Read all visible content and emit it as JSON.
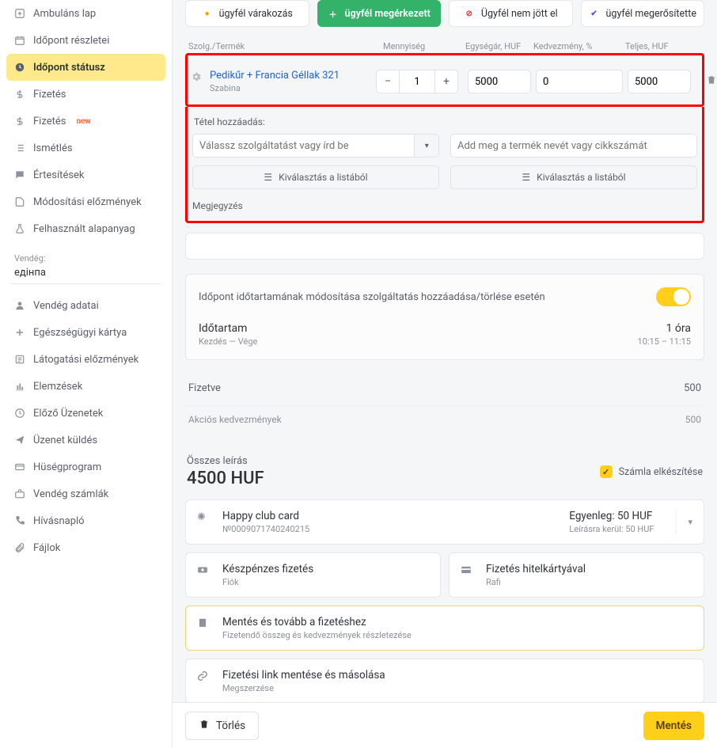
{
  "sidebar": {
    "items": [
      {
        "icon": "plus-square",
        "label": "Ambuláns lap"
      },
      {
        "icon": "calendar",
        "label": "Időpont részletei"
      },
      {
        "icon": "clock",
        "label": "Időpont státusz",
        "active": true
      },
      {
        "icon": "dollar",
        "label": "Fizetés"
      },
      {
        "icon": "dollar",
        "label": "Fizetés",
        "new": true
      },
      {
        "icon": "list",
        "label": "Ismétlés"
      },
      {
        "icon": "chat",
        "label": "Értesítések"
      },
      {
        "icon": "file",
        "label": "Módosítási előzmények"
      },
      {
        "icon": "flask",
        "label": "Felhasznált alapanyag"
      }
    ],
    "guest_label": "Vendég:",
    "guest_name": "едінпа",
    "guest_items": [
      {
        "icon": "user",
        "label": "Vendég adatai"
      },
      {
        "icon": "plus",
        "label": "Egészségügyi kártya"
      },
      {
        "icon": "list2",
        "label": "Látogatási előzmények"
      },
      {
        "icon": "chart",
        "label": "Elemzések"
      },
      {
        "icon": "clock2",
        "label": "Előző Üzenetek"
      },
      {
        "icon": "send",
        "label": "Üzenet küldés"
      },
      {
        "icon": "card",
        "label": "Hüségprogram"
      },
      {
        "icon": "case",
        "label": "Vendég számlák"
      },
      {
        "icon": "phone",
        "label": "Hívásnapló"
      },
      {
        "icon": "clip",
        "label": "Fájlok"
      }
    ]
  },
  "status_tabs": [
    {
      "label": "ügyfél várakozás",
      "color": "#f0a200",
      "mark": "●"
    },
    {
      "label": "ügyfél megérkezett",
      "color": "#fff",
      "mark": "＋",
      "sel": true
    },
    {
      "label": "Ügyfél nem jött el",
      "color": "#e43b3b",
      "mark": "⊘"
    },
    {
      "label": "ügyfél megerősítette",
      "color": "#6b4bd8",
      "mark": "✔"
    }
  ],
  "table": {
    "h_service": "Szolg./Termék",
    "h_qty": "Mennyiség",
    "h_unit": "Egységár, HUF",
    "h_disc": "Kedvezmény, %",
    "h_total": "Teljes, HUF",
    "row": {
      "name": "Pedikűr + Francia Géllak 321",
      "staff": "Szabina",
      "qty": "1",
      "unit": "5000",
      "disc": "0",
      "total": "5000"
    }
  },
  "add": {
    "title": "Tétel hozzáadás:",
    "svc_ph": "Válassz szolgáltatást vagy írd be",
    "prod_ph": "Add meg a termék nevét vagy cikkszámát",
    "pick": "Kiválasztás a listából",
    "note": "Megjegyzés"
  },
  "auto": {
    "label": "Időpont időtartamának módosítása szolgáltatás hozzáadása/törlése esetén",
    "dur_l": "Időtartam",
    "dur_sub": "Kezdés — Vége",
    "dur_v": "1 óra",
    "dur_time": "10:15 – 11:15"
  },
  "sum": {
    "paid_l": "Fizetve",
    "paid_v": "500",
    "promo_l": "Akciós kedvezmények",
    "promo_v": "500"
  },
  "total": {
    "label": "Összes leírás",
    "value": "4500 HUF",
    "chk": "Számla elkészítése"
  },
  "club": {
    "name": "Happy club card",
    "num": "№0009071740240215",
    "bal_l": "Egyenleg: 50 HUF",
    "bal_s": "Leírásra kerül: 50 HUF"
  },
  "pay": {
    "cash": "Készpénzes fizetés",
    "cash_s": "Fiók",
    "card": "Fizetés hitelkártyával",
    "card_s": "Rafi",
    "save": "Mentés és tovább a fizetéshez",
    "save_s": "Fizetendő összeg és kedvezmények részletezése",
    "link": "Fizetési link mentése és másolása",
    "link_s": "Megszerzése"
  },
  "footer": {
    "del": "Törlés",
    "save": "Mentés"
  }
}
